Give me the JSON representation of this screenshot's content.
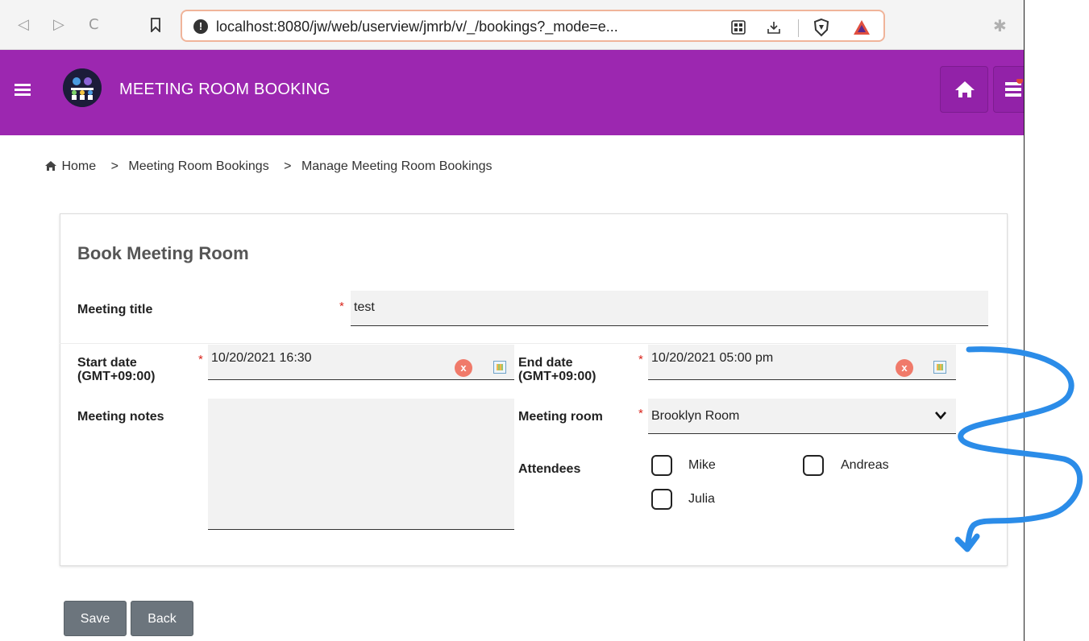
{
  "browser": {
    "url": "localhost:8080/jw/web/userview/jmrb/v/_/bookings?_mode=e...",
    "back_glyph": "◁",
    "forward_glyph": "▷",
    "reload_glyph": "C",
    "bookmark_glyph": "⊓",
    "ext_glyph": "✱"
  },
  "header": {
    "title": "MEETING ROOM BOOKING",
    "color": "#9c27b0"
  },
  "breadcrumb": {
    "home": "Home",
    "sep": ">",
    "level1": "Meeting Room Bookings",
    "level2": "Manage Meeting Room Bookings"
  },
  "form": {
    "title": "Book Meeting Room",
    "required_mark": "*",
    "meeting_title": {
      "label": "Meeting title",
      "value": "test"
    },
    "start_date": {
      "label_line1": "Start date",
      "label_line2": "(GMT+09:00)",
      "value": "10/20/2021 16:30"
    },
    "end_date": {
      "label_line1": "End date",
      "label_line2": "(GMT+09:00)",
      "value": "10/20/2021 05:00 pm"
    },
    "meeting_notes": {
      "label": "Meeting notes",
      "value": ""
    },
    "meeting_room": {
      "label": "Meeting room",
      "value": "Brooklyn Room"
    },
    "attendees": {
      "label": "Attendees",
      "options": [
        {
          "label": "Mike",
          "checked": false
        },
        {
          "label": "Andreas",
          "checked": false
        },
        {
          "label": "Julia",
          "checked": false
        }
      ]
    },
    "clear_glyph": "x"
  },
  "buttons": {
    "save": "Save",
    "back": "Back"
  }
}
